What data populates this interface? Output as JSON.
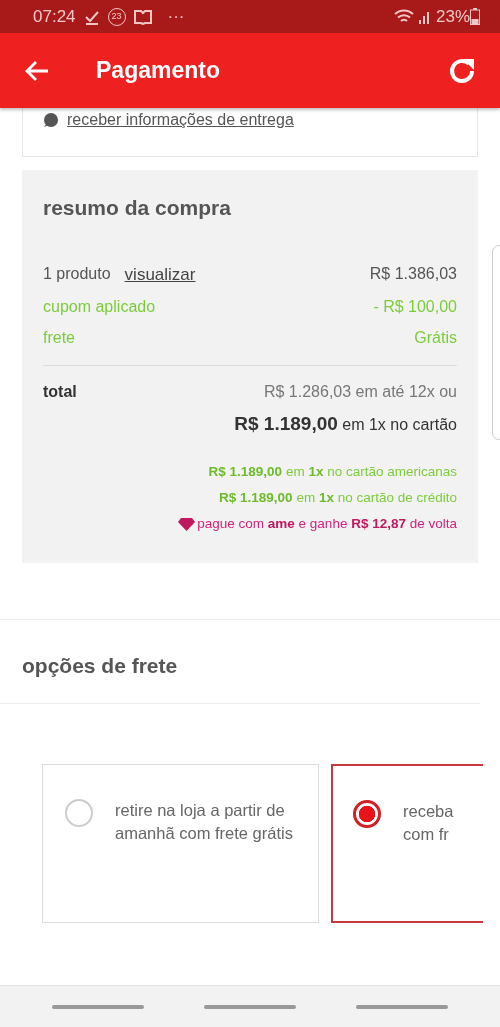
{
  "status_bar": {
    "time": "07:24",
    "notification_count": "23",
    "more": "···",
    "battery": "23%"
  },
  "app_bar": {
    "title": "Pagamento"
  },
  "delivery_info": {
    "link": "receber informações de entrega"
  },
  "summary": {
    "title": "resumo da compra",
    "rows": [
      {
        "kind": "plain",
        "label": "1 produto",
        "link": "visualizar",
        "value": "R$ 1.386,03"
      },
      {
        "kind": "green",
        "label": "cupom aplicado",
        "value": "- R$ 100,00"
      },
      {
        "kind": "green",
        "label": "frete",
        "value": "Grátis"
      }
    ],
    "total": {
      "label": "total",
      "installments": "R$ 1.286,03 em até 12x ou",
      "single": "**R$ 1.189,00** em 1x no cartão"
    },
    "offers": [
      {
        "kind": "green",
        "text": "**R$ 1.189,00** em **1x** no cartão americanas"
      },
      {
        "kind": "green",
        "text": "**R$ 1.189,00** em **1x** no cartão de crédito"
      },
      {
        "kind": "ame",
        "text": "pague com **ame** e ganhe **R$ 12,87** de volta"
      }
    ]
  },
  "shipping": {
    "title": "opções de frete",
    "options": [
      {
        "label": "retire na loja a partir de amanhã com frete grátis",
        "selected": false
      },
      {
        "label": "receba com fr",
        "selected": true
      }
    ]
  }
}
